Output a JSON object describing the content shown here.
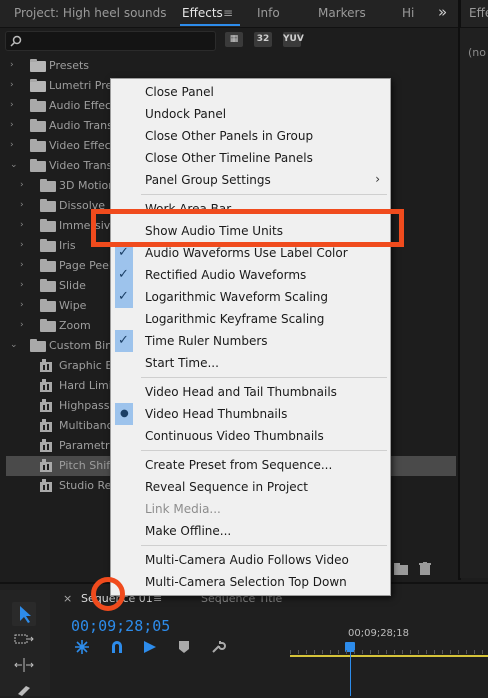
{
  "tabs": {
    "project": "Project: High heel sounds",
    "effects": "Effects",
    "menu_icon": "≡",
    "info": "Info",
    "markers": "Markers",
    "hi": "Hi",
    "overflow": "»",
    "right_tab": "Effe",
    "right_text": "(no"
  },
  "effects_search": {
    "placeholder": "",
    "badges": [
      "32",
      "YUV"
    ]
  },
  "tree": [
    {
      "label": "Presets",
      "level": 0,
      "icon": "star-folder-icon"
    },
    {
      "label": "Lumetri Pres",
      "level": 0,
      "icon": "star-folder-icon"
    },
    {
      "label": "Audio Effects",
      "level": 0,
      "icon": "folder-icon"
    },
    {
      "label": "Audio Transi",
      "level": 0,
      "icon": "folder-icon"
    },
    {
      "label": "Video Effects",
      "level": 0,
      "icon": "folder-icon"
    },
    {
      "label": "Video Transi",
      "level": 0,
      "icon": "folder-icon",
      "expanded": true
    },
    {
      "label": "3D Motion",
      "level": 1,
      "icon": "folder-icon"
    },
    {
      "label": "Dissolve",
      "level": 1,
      "icon": "folder-icon"
    },
    {
      "label": "Immersive",
      "level": 1,
      "icon": "folder-icon"
    },
    {
      "label": "Iris",
      "level": 1,
      "icon": "folder-icon"
    },
    {
      "label": "Page Peel",
      "level": 1,
      "icon": "folder-icon"
    },
    {
      "label": "Slide",
      "level": 1,
      "icon": "folder-icon"
    },
    {
      "label": "Wipe",
      "level": 1,
      "icon": "folder-icon"
    },
    {
      "label": "Zoom",
      "level": 1,
      "icon": "folder-icon"
    },
    {
      "label": "Custom Bin 0",
      "level": 0,
      "icon": "folder-icon",
      "expanded": true
    },
    {
      "label": "Graphic Eq",
      "level": 1,
      "icon": "audio-effect-icon"
    },
    {
      "label": "Hard Limit",
      "level": 1,
      "icon": "audio-effect-icon"
    },
    {
      "label": "Highpass",
      "level": 1,
      "icon": "audio-effect-icon"
    },
    {
      "label": "Multiband",
      "level": 1,
      "icon": "audio-effect-icon"
    },
    {
      "label": "Parametri",
      "level": 1,
      "icon": "audio-effect-icon"
    },
    {
      "label": "Pitch Shift",
      "level": 1,
      "icon": "audio-effect-icon",
      "selected": true
    },
    {
      "label": "Studio Rev",
      "level": 1,
      "icon": "audio-effect-icon"
    }
  ],
  "context_menu": {
    "items": [
      {
        "label": "Close Panel"
      },
      {
        "label": "Undock Panel"
      },
      {
        "label": "Close Other Panels in Group"
      },
      {
        "label": "Close Other Timeline Panels"
      },
      {
        "label": "Panel Group Settings",
        "submenu": true
      },
      {
        "label": "Work Area Bar"
      },
      {
        "label": "Show Audio Time Units"
      },
      {
        "label": "Audio Waveforms Use Label Color",
        "check": "check"
      },
      {
        "label": "Rectified Audio Waveforms",
        "check": "check"
      },
      {
        "label": "Logarithmic Waveform Scaling",
        "check": "check"
      },
      {
        "label": "Logarithmic Keyframe Scaling"
      },
      {
        "label": "Time Ruler Numbers",
        "check": "check"
      },
      {
        "label": "Start Time..."
      },
      {
        "label": "Video Head and Tail Thumbnails"
      },
      {
        "label": "Video Head Thumbnails",
        "check": "dot"
      },
      {
        "label": "Continuous Video Thumbnails"
      },
      {
        "label": "Create Preset from Sequence..."
      },
      {
        "label": "Reveal Sequence in Project"
      },
      {
        "label": "Link Media...",
        "disabled": true
      },
      {
        "label": "Make Offline..."
      },
      {
        "label": "Multi-Camera Audio Follows Video"
      },
      {
        "label": "Multi-Camera Selection Top Down"
      }
    ]
  },
  "timeline": {
    "close": "×",
    "sequence_tab": "Sequence 01",
    "tab_menu": "≡",
    "sequence_title": "Sequence Title",
    "timecode": "00;09;28;05",
    "ruler_timecode": "00;09;28;18"
  },
  "colors": {
    "accent": "#2d8ceb",
    "annotation": "#f04b1d",
    "check_bg": "#9dc3ec"
  }
}
